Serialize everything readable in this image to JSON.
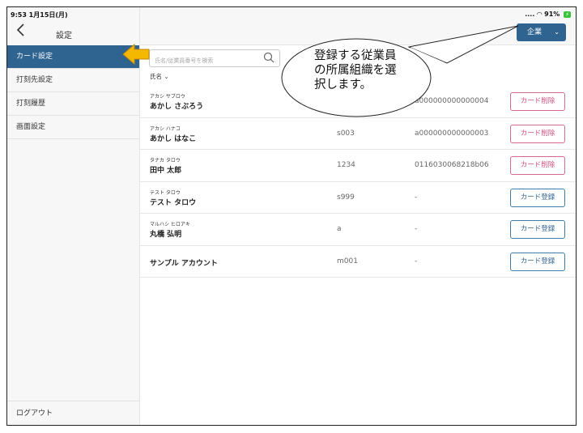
{
  "status": {
    "time_date": "9:53  1月15日(月)",
    "battery_text": "91%"
  },
  "sidebar": {
    "title": "設定",
    "back_icon": "chevron-left-icon",
    "items": [
      {
        "label": "カード設定",
        "active": true
      },
      {
        "label": "打刻先設定",
        "active": false
      },
      {
        "label": "打刻履歴",
        "active": false
      },
      {
        "label": "画面設定",
        "active": false
      }
    ],
    "logout_label": "ログアウト"
  },
  "header": {
    "company_label": "企業",
    "company_chevron": "chevron-down-icon"
  },
  "search": {
    "placeholder": "氏名/従業員番号を検索",
    "icon": "search-icon"
  },
  "sort": {
    "label": "氏名 ⌄"
  },
  "employees": [
    {
      "kana": "アカシ サブロウ",
      "name": "あかし さぶろう",
      "code": "",
      "card": "a000000000000004",
      "action": "カード削除",
      "action_type": "delete"
    },
    {
      "kana": "アカシ ハナコ",
      "name": "あかし はなこ",
      "code": "s003",
      "card": "a000000000000003",
      "action": "カード削除",
      "action_type": "delete"
    },
    {
      "kana": "タナカ タロウ",
      "name": "田中 太郎",
      "code": "1234",
      "card": "0116030068218b06",
      "action": "カード削除",
      "action_type": "delete"
    },
    {
      "kana": "テスト タロウ",
      "name": "テスト タロウ",
      "code": "s999",
      "card": "-",
      "action": "カード登録",
      "action_type": "register"
    },
    {
      "kana": "マルハシ ヒロアキ",
      "name": "丸橋 弘明",
      "code": "a",
      "card": "-",
      "action": "カード登録",
      "action_type": "register"
    },
    {
      "kana": "",
      "name": "サンプル アカウント",
      "code": "m001",
      "card": "-",
      "action": "カード登録",
      "action_type": "register"
    }
  ],
  "annotation": {
    "lines": [
      "登録する従業員",
      "の所属組織を選",
      "択します。"
    ],
    "arrow_color": "#f5b800"
  },
  "colors": {
    "accent": "#2f6390",
    "delete": "#d4507a"
  }
}
